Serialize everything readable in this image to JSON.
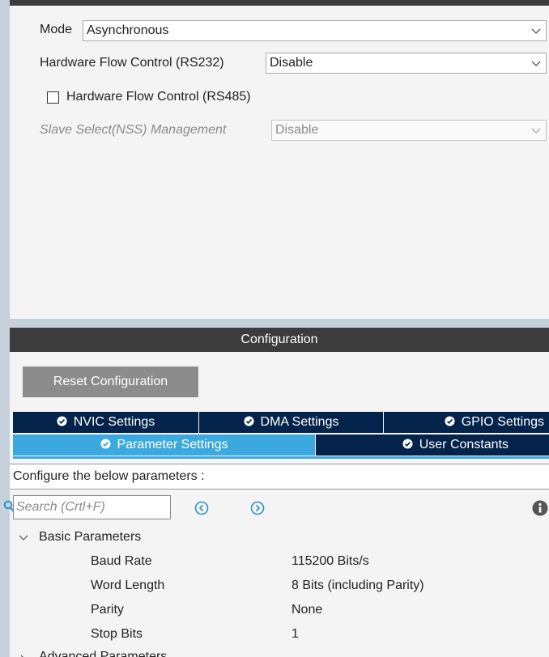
{
  "mode_panel": {
    "mode": {
      "label": "Mode",
      "value": "Asynchronous"
    },
    "hw_flow_rs232": {
      "label": "Hardware Flow Control (RS232)",
      "value": "Disable"
    },
    "hw_flow_rs485": {
      "label": "Hardware Flow Control (RS485)",
      "checked": false
    },
    "slave_select": {
      "label": "Slave Select(NSS) Management",
      "value": "Disable"
    }
  },
  "config_panel": {
    "title": "Configuration",
    "reset_label": "Reset Configuration",
    "tabs_row1": [
      {
        "label": "NVIC Settings",
        "icon": "check-circle-icon"
      },
      {
        "label": "DMA Settings",
        "icon": "check-circle-icon"
      },
      {
        "label": "GPIO Settings",
        "icon": "check-circle-icon"
      }
    ],
    "tabs_row2": [
      {
        "label": "Parameter Settings",
        "icon": "check-circle-icon",
        "active": true
      },
      {
        "label": "User Constants",
        "icon": "check-circle-icon"
      }
    ],
    "param_hint": "Configure the below parameters :",
    "search": {
      "placeholder": "Search (Crtl+F)"
    },
    "groups": [
      {
        "label": "Basic Parameters",
        "expanded": true,
        "params": [
          {
            "name": "Baud Rate",
            "value": "115200 Bits/s"
          },
          {
            "name": "Word Length",
            "value": "8 Bits (including Parity)"
          },
          {
            "name": "Parity",
            "value": "None"
          },
          {
            "name": "Stop Bits",
            "value": "1"
          }
        ]
      },
      {
        "label": "Advanced Parameters",
        "expanded": false
      }
    ]
  },
  "colors": {
    "header_bg": "#3c3c3c",
    "tab_dark": "#03234b",
    "tab_active": "#3ca9de",
    "reset_button": "#8c8c8c",
    "nav_icon": "#2d8fd0"
  }
}
